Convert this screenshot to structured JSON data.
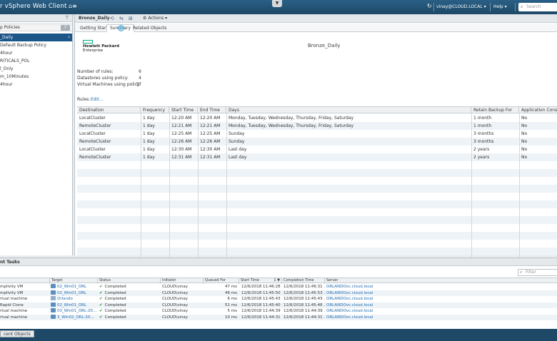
{
  "header": {
    "app_title": "r vSphere Web Client",
    "home_icon": "home-icon",
    "user": "vinay@CLOUD.LOCAL ▾",
    "help": "Help ▾",
    "search_placeholder": "Search"
  },
  "navigator": {
    "crumb": "p Policies",
    "count": "7",
    "items": [
      {
        "label": "_Daily",
        "selected": true
      },
      {
        "label": "Default Backup Policy"
      },
      {
        "label": "4hour"
      },
      {
        "label": "RITICALS_POL"
      },
      {
        "label": "l_Only"
      },
      {
        "label": "m_10Minutes"
      },
      {
        "label": "4hour"
      }
    ]
  },
  "object": {
    "name": "Bronze_Daily",
    "actions_label": "Actions ▾",
    "tabs": [
      "Getting Started",
      "Summary",
      "Related Objects"
    ],
    "active_tab": "Summary"
  },
  "summary": {
    "logo_line1": "Hewlett Packard",
    "logo_line2": "Enterprise",
    "policy_name": "Bronze_Daily",
    "stats": [
      {
        "label": "Number of rules:",
        "value": "6"
      },
      {
        "label": "Datastores using policy:",
        "value": "4"
      },
      {
        "label": "Virtual Machines using policy:",
        "value": "37"
      }
    ],
    "rules_label": "Rules:",
    "edit_label": "Edit..."
  },
  "rules_table": {
    "columns": [
      "Destination",
      "Frequency",
      "Start Time",
      "End Time",
      "Days",
      "Retain Backup For",
      "Application Consistent"
    ],
    "rows": [
      [
        "LocalCluster",
        "1 day",
        "12:20 AM",
        "12:20 AM",
        "Monday, Tuesday, Wednesday, Thursday, Friday, Saturday",
        "1 month",
        "No"
      ],
      [
        "RemoteCluster",
        "1 day",
        "12:21 AM",
        "12:21 AM",
        "Monday, Tuesday, Wednesday, Thursday, Friday, Saturday",
        "1 month",
        "No"
      ],
      [
        "LocalCluster",
        "1 day",
        "12:25 AM",
        "12:25 AM",
        "Sunday",
        "3 months",
        "No"
      ],
      [
        "RemoteCluster",
        "1 day",
        "12:26 AM",
        "12:26 AM",
        "Sunday",
        "3 months",
        "No"
      ],
      [
        "LocalCluster",
        "1 day",
        "12:30 AM",
        "12:30 AM",
        "Last day",
        "2 years",
        "No"
      ],
      [
        "RemoteCluster",
        "1 day",
        "12:31 AM",
        "12:31 AM",
        "Last day",
        "2 years",
        "No"
      ]
    ]
  },
  "tasks": {
    "title": "nt Tasks",
    "filter_placeholder": "Filter",
    "columns": [
      "",
      "Target",
      "Status",
      "Initiator",
      "Queued For",
      "Start Time",
      "Completion Time",
      "Server"
    ],
    "sort_indicator": "1 ▼",
    "rows": [
      {
        "name": "mplivity VM",
        "target": "02_Win01_ORL",
        "status": "Completed",
        "initiator": "CLOUD\\vinay",
        "queued": "47 ms",
        "start": "12/6/2018 11:46:28 ...",
        "completion": "12/6/2018 11:46:31 ...",
        "server": "ORLANDOvc.cloud.local"
      },
      {
        "name": "mplivity VM",
        "target": "02_Win01_ORL",
        "status": "Completed",
        "initiator": "CLOUD\\vinay",
        "queued": "46 ms",
        "start": "12/6/2018 11:45:50 ...",
        "completion": "12/6/2018 11:45:53 ...",
        "server": "ORLANDOvc.cloud.local"
      },
      {
        "name": "rtual machine",
        "target": "Orlando",
        "status": "Completed",
        "initiator": "CLOUD\\vinay",
        "queued": "6 ms",
        "start": "12/6/2018 11:45:43 ...",
        "completion": "12/6/2018 11:45:43 ...",
        "server": "ORLANDOvc.cloud.local"
      },
      {
        "name": "Rapid Clone",
        "target": "02_Win01_ORL",
        "status": "Completed",
        "initiator": "CLOUD\\vinay",
        "queued": "51 ms",
        "start": "12/6/2018 11:45:40 ...",
        "completion": "12/6/2018 11:45:46 ...",
        "server": "ORLANDOvc.cloud.local"
      },
      {
        "name": "rtual machine",
        "target": "03_Win01_ORL-20...",
        "status": "Completed",
        "initiator": "CLOUD\\vinay",
        "queued": "5 ms",
        "start": "12/6/2018 11:44:39 ...",
        "completion": "12/6/2018 11:44:39 ...",
        "server": "ORLANDOvc.cloud.local"
      },
      {
        "name": "rtual machine",
        "target": "3_Win02_ORL-20...",
        "status": "Completed",
        "initiator": "CLOUD\\vinay",
        "queued": "10 ms",
        "start": "12/6/2018 11:44:31 ...",
        "completion": "12/6/2018 11:44:31 ...",
        "server": "ORLANDOvc.cloud.local"
      }
    ]
  },
  "bottom": {
    "recent_objects": "cent Objects"
  },
  "colors": {
    "header_bg": "#1d4866",
    "selected_bg": "#1c5588",
    "link": "#1f6bb0",
    "hpe_green": "#01a982",
    "status_ok": "#2d8a2d"
  }
}
